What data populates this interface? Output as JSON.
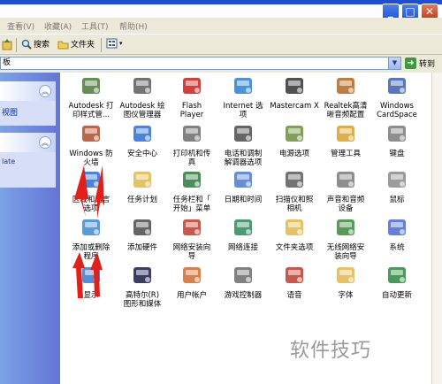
{
  "window": {
    "controls": [
      "_",
      "□",
      "✕"
    ]
  },
  "menu": [
    "查看(V)",
    "收藏(A)",
    "工具(T)",
    "帮助(H)"
  ],
  "toolbar": {
    "search_label": "搜索",
    "folders_label": "文件夹"
  },
  "address": {
    "value": "板",
    "go_label": "转到"
  },
  "side_pane": {
    "link_1": "视图",
    "text_1": "late"
  },
  "items": [
    {
      "label": "Autodesk 打\n印样式管...",
      "icon": "printer-style-icon",
      "color": "#4a7a3a"
    },
    {
      "label": "Autodesk 绘\n图仪管理器",
      "icon": "plotter-icon",
      "color": "#5b5b5b"
    },
    {
      "label": "Flash\nPlayer",
      "icon": "flash-icon",
      "color": "#c8201a"
    },
    {
      "label": "Internet 选\n项",
      "icon": "internet-options-icon",
      "color": "#2a7fd4"
    },
    {
      "label": "Mastercam X",
      "icon": "mastercam-icon",
      "color": "#333333"
    },
    {
      "label": "Realtek高清\n晰音频配置",
      "icon": "speaker-icon",
      "color": "#b5651d"
    },
    {
      "label": "Windows\nCardSpace",
      "icon": "cardspace-icon",
      "color": "#3a5fb0"
    },
    {
      "label": "Windows 防\n火墙",
      "icon": "firewall-icon",
      "color": "#b24a2a"
    },
    {
      "label": "安全中心",
      "icon": "shield-icon",
      "color": "#2b6fd6"
    },
    {
      "label": "打印机和传\n真",
      "icon": "printer-icon",
      "color": "#6b6b6b"
    },
    {
      "label": "电话和调制\n解调器选项",
      "icon": "phone-icon",
      "color": "#4a4a4a"
    },
    {
      "label": "电源选项",
      "icon": "power-icon",
      "color": "#6a8f3a"
    },
    {
      "label": "管理工具",
      "icon": "admin-tools-icon",
      "color": "#d9a02a"
    },
    {
      "label": "键盘",
      "icon": "keyboard-icon",
      "color": "#7a7a7a"
    },
    {
      "label": "区域和语言\n选项",
      "icon": "globe-icon",
      "color": "#2a6fd4"
    },
    {
      "label": "任务计划",
      "icon": "task-folder-icon",
      "color": "#e0b84a"
    },
    {
      "label": "任务栏和「\n开始」菜单",
      "icon": "taskbar-icon",
      "color": "#2b7a3a"
    },
    {
      "label": "日期和时间",
      "icon": "clock-icon",
      "color": "#4a7ad4"
    },
    {
      "label": "扫描仪和照\n相机",
      "icon": "camera-icon",
      "color": "#5a5a5a"
    },
    {
      "label": "声音和音频\n设备",
      "icon": "sound-icon",
      "color": "#7a7a7a"
    },
    {
      "label": "鼠标",
      "icon": "mouse-icon",
      "color": "#8a8a8a"
    },
    {
      "label": "添加或删除\n程序",
      "icon": "add-remove-programs-icon",
      "color": "#3a8ad4"
    },
    {
      "label": "添加硬件",
      "icon": "hardware-icon",
      "color": "#4a4a4a"
    },
    {
      "label": "网络安装向\n导",
      "icon": "network-wizard-icon",
      "color": "#c0392b"
    },
    {
      "label": "网络连接",
      "icon": "network-icon",
      "color": "#2a8a5a"
    },
    {
      "label": "文件夹选项",
      "icon": "folder-options-icon",
      "color": "#e0b84a"
    },
    {
      "label": "无线网络安\n装向导",
      "icon": "wireless-icon",
      "color": "#3a8a3a"
    },
    {
      "label": "系统",
      "icon": "system-icon",
      "color": "#4a6ad4"
    },
    {
      "label": "显示",
      "icon": "display-icon",
      "color": "#3a7ad4"
    },
    {
      "label": "高特尔(R)\n图形和媒体",
      "icon": "graphics-icon",
      "color": "#1a1a4a"
    },
    {
      "label": "用户帐户",
      "icon": "user-accounts-icon",
      "color": "#d46a2a"
    },
    {
      "label": "游戏控制器",
      "icon": "gamepad-icon",
      "color": "#6a6a6a"
    },
    {
      "label": "语音",
      "icon": "speech-icon",
      "color": "#c0392b"
    },
    {
      "label": "字体",
      "icon": "font-folder-icon",
      "color": "#e0b84a"
    },
    {
      "label": "自动更新",
      "icon": "windows-update-icon",
      "color": "#2a8a3a"
    }
  ],
  "watermark": "软件技巧",
  "annotation_color": "#e0201a"
}
